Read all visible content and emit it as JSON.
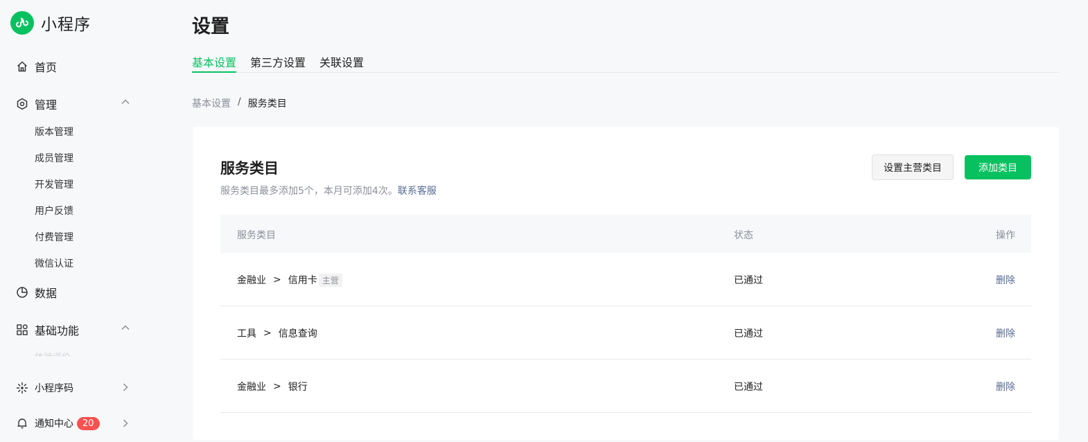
{
  "app": {
    "name": "小程序"
  },
  "sidebar": {
    "home": "首页",
    "manage": "管理",
    "manage_items": [
      "版本管理",
      "成员管理",
      "开发管理",
      "用户反馈",
      "付费管理",
      "微信认证"
    ],
    "data": "数据",
    "basic": "基础功能",
    "basic_first_partial": "体验评价",
    "qrcode": "小程序码",
    "notify": "通知中心",
    "notify_count": "20"
  },
  "page": {
    "title": "设置",
    "tabs": [
      "基本设置",
      "第三方设置",
      "关联设置"
    ],
    "active_tab": 0
  },
  "breadcrumb": {
    "parent": "基本设置",
    "sep": "/",
    "current": "服务类目"
  },
  "card": {
    "title": "服务类目",
    "desc": "服务类目最多添加5个，本月可添加4次。",
    "desc_link": "联系客服",
    "btn_set_main": "设置主营类目",
    "btn_add": "添加类目"
  },
  "table": {
    "headers": {
      "category": "服务类目",
      "status": "状态",
      "action": "操作"
    },
    "separator": ">",
    "rows": [
      {
        "l1": "金融业",
        "l2": "信用卡",
        "tag": "主营",
        "status": "已通过",
        "action": "删除"
      },
      {
        "l1": "工具",
        "l2": "信息查询",
        "tag": "",
        "status": "已通过",
        "action": "删除"
      },
      {
        "l1": "金融业",
        "l2": "银行",
        "tag": "",
        "status": "已通过",
        "action": "删除"
      }
    ]
  },
  "colors": {
    "brand": "#07c160",
    "link": "#576b95",
    "badge": "#fa5151"
  },
  "icons": [
    "miniprogram-logo-icon",
    "home-icon",
    "hexagon-settings-icon",
    "chevron-up-icon",
    "pie-chart-icon",
    "grid-icon",
    "qrcode-sparkle-icon",
    "bell-icon",
    "chevron-right-icon"
  ]
}
